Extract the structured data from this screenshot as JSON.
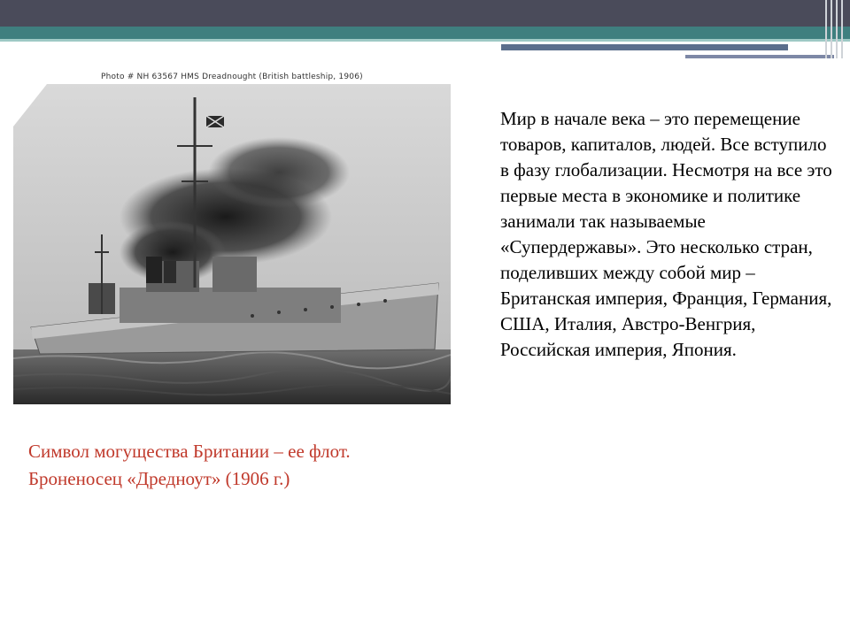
{
  "slide": {
    "photo_caption": "Photo # NH 63567   HMS Dreadnought (British battleship, 1906)",
    "caption": "Символ могущества Британии – ее флот. Броненосец «Дредноут» (1906 г.)",
    "main_text": "Мир в начале века – это перемещение товаров, капиталов, людей. Все вступило в фазу глобализации. Несмотря на все это первые места в экономике и политике занимали так называемые «Супердержавы». Это несколько стран, поделивших между собой мир – Британская империя, Франция, Германия, США, Италия, Австро-Венгрия, Российская империя, Япония."
  },
  "colors": {
    "caption": "#c0392b",
    "header_bar": "#4a4b5a",
    "header_teal": "#3f7f7f"
  }
}
